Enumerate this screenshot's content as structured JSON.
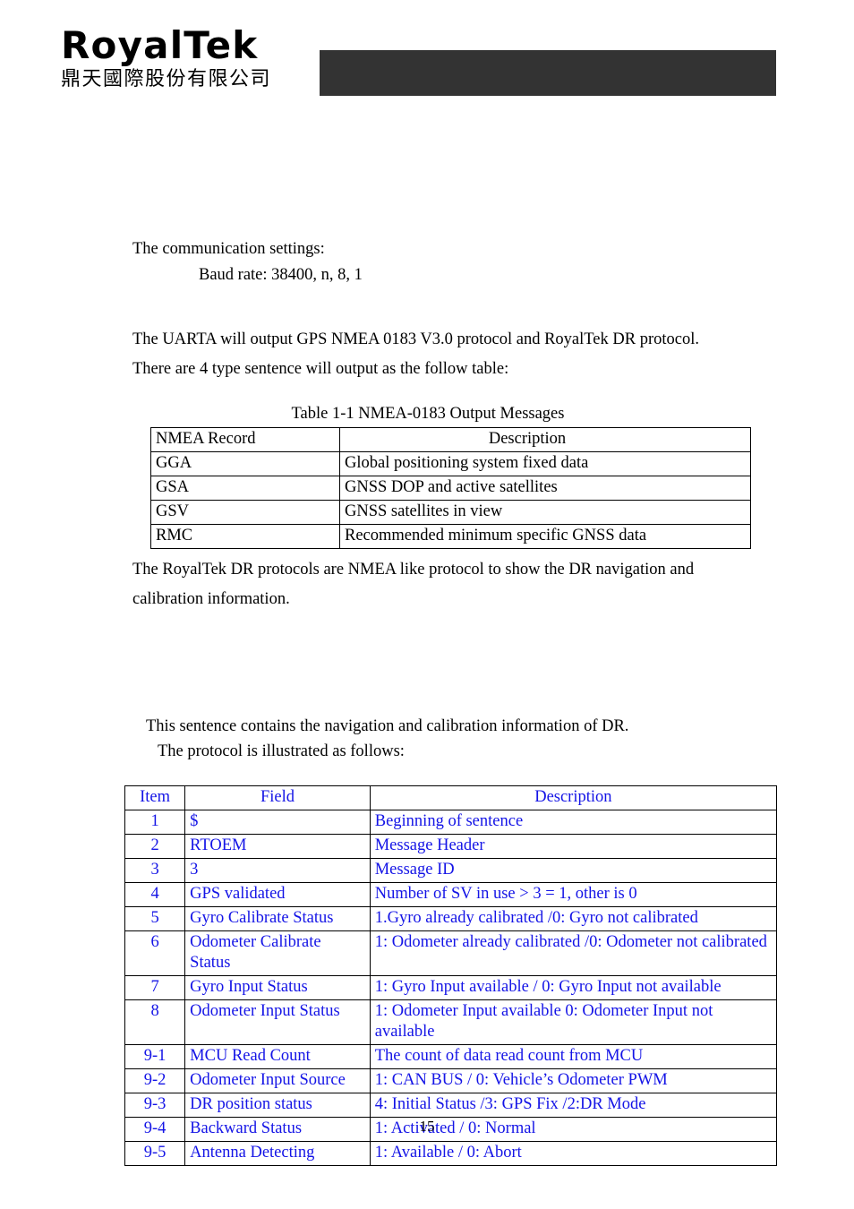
{
  "header": {
    "logo_wordmark": "RoyalTek",
    "logo_company_cjk": "鼎天國際股份有限公司",
    "bar_color": "#333333"
  },
  "body": {
    "comm_settings_line": "The communication settings:",
    "baud_rate_line": "Baud rate: 38400, n, 8, 1",
    "uarta_paragraph": "The UARTA will output GPS NMEA 0183 V3.0 protocol and RoyalTek DR protocol.\nThere are 4 type sentence will output as the follow table:",
    "dr_protocol_paragraph": "The RoyalTek DR protocols are NMEA like protocol to show the DR navigation and\ncalibration information.",
    "sentence_intro_line": "This sentence contains the navigation and calibration information of DR.",
    "protocol_illustrated_line": "The protocol is illustrated as follows:"
  },
  "nmea_table": {
    "caption": "Table 1-1 NMEA-0183 Output Messages",
    "headers": [
      "NMEA Record",
      "Description"
    ],
    "rows": [
      [
        "GGA",
        "Global positioning system fixed data"
      ],
      [
        "GSA",
        "GNSS DOP and active satellites"
      ],
      [
        "GSV",
        "GNSS satellites in view"
      ],
      [
        "RMC",
        "Recommended minimum specific GNSS data"
      ]
    ]
  },
  "rtoem_table": {
    "text_color": "#1414e6",
    "headers": [
      "Item",
      "Field",
      "Description"
    ],
    "rows": [
      [
        "1",
        "$",
        "Beginning of sentence"
      ],
      [
        "2",
        "RTOEM",
        "Message Header"
      ],
      [
        "3",
        "3",
        "Message ID"
      ],
      [
        "4",
        "GPS validated",
        "Number of SV in use > 3 = 1, other is 0"
      ],
      [
        "5",
        "Gyro Calibrate Status",
        "1.Gyro already calibrated /0: Gyro not calibrated"
      ],
      [
        "6",
        "Odometer Calibrate Status",
        "1: Odometer already calibrated /0: Odometer not calibrated"
      ],
      [
        "7",
        "Gyro Input Status",
        "1: Gyro Input available / 0: Gyro Input not available"
      ],
      [
        "8",
        "Odometer Input Status",
        "1: Odometer Input available 0: Odometer Input not available"
      ],
      [
        "9-1",
        "MCU Read Count",
        "The count of data read count from MCU"
      ],
      [
        "9-2",
        "Odometer Input Source",
        "1: CAN BUS / 0: Vehicle’s Odometer PWM"
      ],
      [
        "9-3",
        "DR position status",
        "4: Initial Status /3: GPS Fix /2:DR Mode"
      ],
      [
        "9-4",
        "Backward Status",
        "1: Activated / 0: Normal"
      ],
      [
        "9-5",
        "Antenna Detecting",
        "1: Available / 0: Abort"
      ]
    ]
  },
  "footer": {
    "page_number": "15"
  }
}
